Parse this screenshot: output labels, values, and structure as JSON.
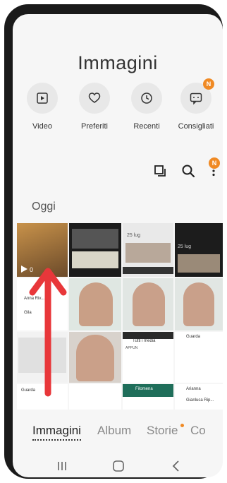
{
  "header": {
    "title": "Immagini"
  },
  "shortcuts": [
    {
      "label": "Video",
      "icon": "video-icon"
    },
    {
      "label": "Preferiti",
      "icon": "heart-icon"
    },
    {
      "label": "Recenti",
      "icon": "clock-icon"
    },
    {
      "label": "Consigliati",
      "icon": "suggested-icon",
      "badge": "N"
    }
  ],
  "toolbar": {
    "more_badge": "N"
  },
  "section": {
    "title": "Oggi"
  },
  "grid": {
    "video_duration": "0",
    "tile_dates": [
      "25 lug",
      "25 lug"
    ],
    "chat_names": [
      "Anna Riv...",
      "Gila",
      "Arianna",
      "Gianluca Rip..."
    ],
    "chat_labels": [
      "Tutti i media",
      "Filomena",
      "Guarda",
      "Guarda"
    ],
    "section_label": "APPUN"
  },
  "tabs": [
    {
      "label": "Immagini",
      "active": true
    },
    {
      "label": "Album",
      "active": false
    },
    {
      "label": "Storie",
      "active": false,
      "dot": true
    },
    {
      "label": "Co",
      "active": false
    }
  ],
  "navbar": [
    "recents-nav-icon",
    "home-nav-icon",
    "back-nav-icon"
  ],
  "colors": {
    "accent": "#f08a24",
    "arrow": "#e8373a",
    "text": "#333333"
  }
}
